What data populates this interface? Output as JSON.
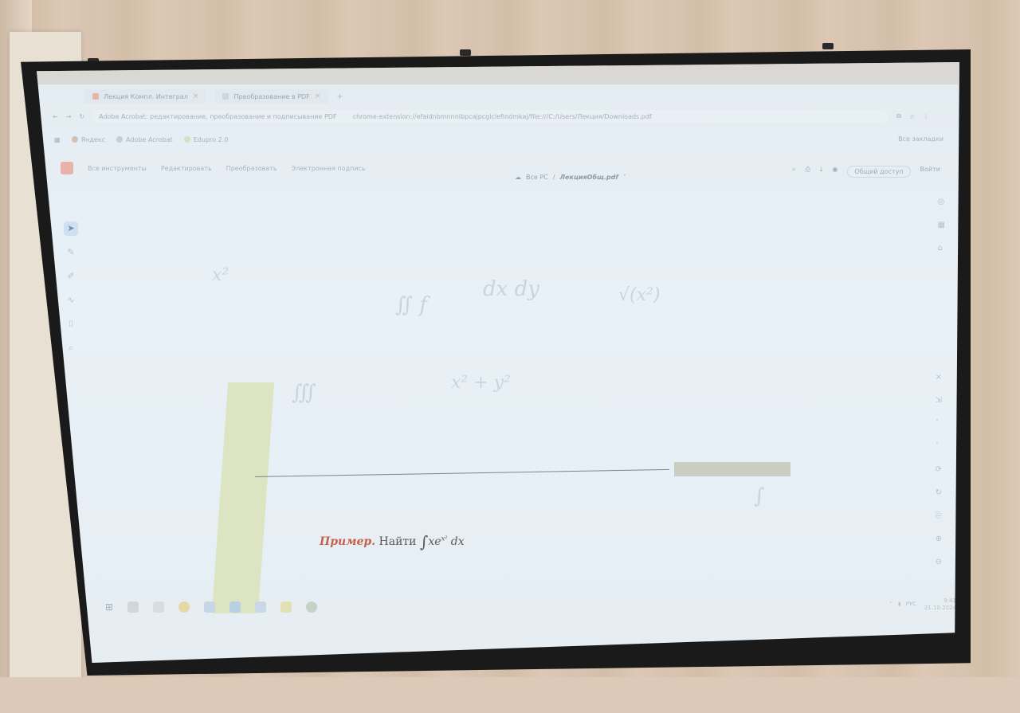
{
  "browser": {
    "tabs": [
      {
        "label": "Лекция Компл. Интеграл",
        "active": true
      },
      {
        "label": "Преобразование в PDF",
        "active": false
      }
    ],
    "url_site": "Adobe Acrobat: редактирование, преобразование и подписывание PDF",
    "url": "chrome-extension://efaidnbmnnnibpcajpcglclefindmkaj/file:///C:/Users/Лекция/Downloads.pdf",
    "bookmarks": [
      "Яндекс",
      "Adobe Acrobat",
      "Edupro 2.0"
    ],
    "all_bookmarks": "Все закладки"
  },
  "acrobat": {
    "menu": [
      "Все инструменты",
      "Редактировать",
      "Преобразовать",
      "Электронная подпись"
    ],
    "file_prefix": "Все PC",
    "file_name": "ЛекцияОбщ.pdf",
    "share_label": "Общий доступ",
    "signin_label": "Войти"
  },
  "document": {
    "example_label": "Пример.",
    "example_text": "Найти",
    "integral_sign": "∫",
    "expr_base": "xe",
    "expr_exp": "x²",
    "expr_dx": "dx",
    "ghost_marks": [
      "x²",
      "∬ f",
      "dx dy",
      "∭",
      "x² + y²",
      "√(x²)",
      "∫"
    ]
  },
  "taskbar": {
    "time": "9:41",
    "date": "21.10.2024",
    "lang": "РУС"
  },
  "colors": {
    "screen_bg": "#e6eef4",
    "example_accent": "#c5604a",
    "margin_bar": "#d9e2b8"
  }
}
